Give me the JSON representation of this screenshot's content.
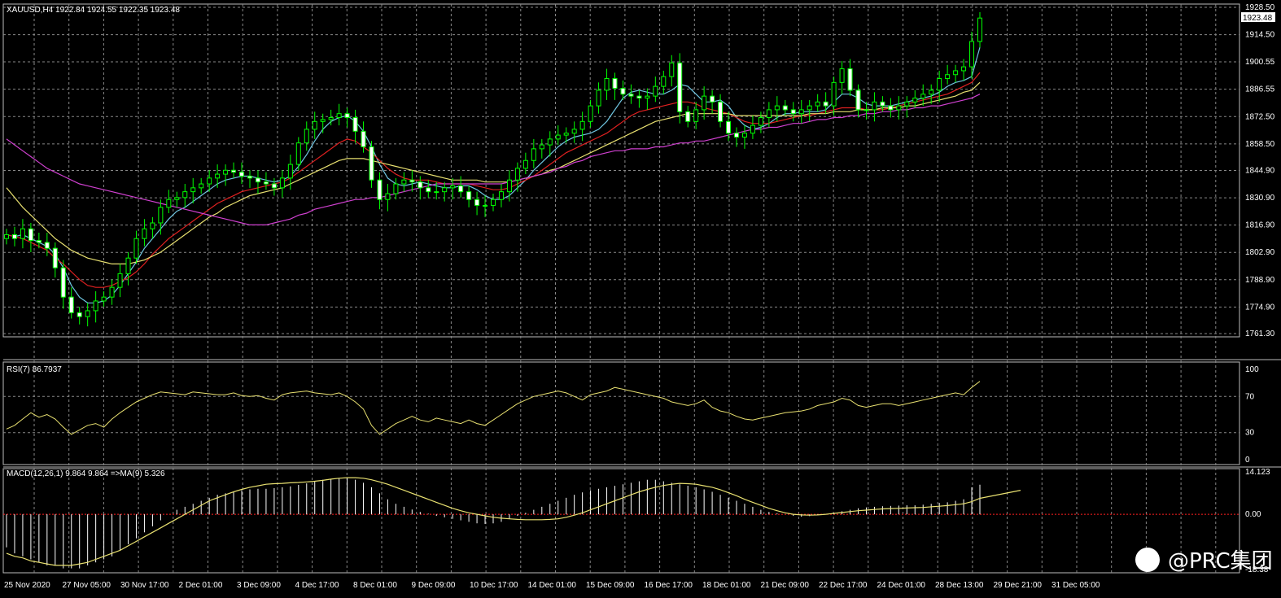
{
  "chart_data": {
    "type": "candlestick",
    "symbol_line": "XAUUSD,H4  1922.84 1924.55 1922.35 1923.48",
    "price_ticks": [
      "1928.50",
      "1914.50",
      "1900.55",
      "1886.55",
      "1872.50",
      "1858.50",
      "1844.90",
      "1830.90",
      "1816.90",
      "1802.90",
      "1788.90",
      "1774.90",
      "1761.30"
    ],
    "current_price": "1923.48",
    "ylim": [
      1761.3,
      1928.5
    ],
    "x_labels": [
      "25 Nov 2020",
      "27 Nov 05:00",
      "30 Nov 17:00",
      "2 Dec 01:00",
      "3 Dec 09:00",
      "4 Dec 17:00",
      "8 Dec 01:00",
      "9 Dec 09:00",
      "10 Dec 17:00",
      "14 Dec 01:00",
      "15 Dec 09:00",
      "16 Dec 17:00",
      "18 Dec 01:00",
      "21 Dec 09:00",
      "22 Dec 17:00",
      "24 Dec 01:00",
      "28 Dec 13:00",
      "29 Dec 21:00",
      "31 Dec 05:00"
    ],
    "price_series": [
      {
        "color": "#6fc5e0",
        "values": [
          1812,
          1811,
          1812,
          1810,
          1808,
          1806,
          1802,
          1795,
          1786,
          1780,
          1777,
          1777,
          1778,
          1781,
          1786,
          1792,
          1798,
          1805,
          1810,
          1815,
          1820,
          1824,
          1826,
          1829,
          1832,
          1835,
          1838,
          1840,
          1841,
          1842,
          1842,
          1841,
          1840,
          1839,
          1840,
          1842,
          1847,
          1853,
          1860,
          1866,
          1870,
          1872,
          1873,
          1870,
          1865,
          1857,
          1848,
          1841,
          1838,
          1837,
          1838,
          1839,
          1838,
          1837,
          1836,
          1836,
          1837,
          1837,
          1835,
          1832,
          1830,
          1830,
          1832,
          1836,
          1840,
          1845,
          1849,
          1853,
          1857,
          1860,
          1862,
          1863,
          1864,
          1866,
          1870,
          1876,
          1882,
          1885,
          1886,
          1885,
          1884,
          1884,
          1886,
          1889,
          1888,
          1884,
          1880,
          1880,
          1881,
          1878,
          1872,
          1868,
          1866,
          1867,
          1869,
          1872,
          1874,
          1874,
          1875,
          1875,
          1875,
          1876,
          1880,
          1884,
          1884,
          1882,
          1879,
          1878,
          1878,
          1878,
          1879,
          1880,
          1881,
          1882,
          1883,
          1885,
          1888,
          1890,
          1891,
          1893,
          1908
        ]
      },
      {
        "color": "#e02020",
        "values": [
          1812,
          1811,
          1810,
          1808,
          1806,
          1804,
          1800,
          1797,
          1793,
          1789,
          1786,
          1785,
          1785,
          1786,
          1788,
          1790,
          1793,
          1797,
          1802,
          1806,
          1810,
          1813,
          1816,
          1819,
          1822,
          1825,
          1828,
          1830,
          1832,
          1834,
          1835,
          1836,
          1837,
          1838,
          1839,
          1841,
          1844,
          1847,
          1850,
          1853,
          1856,
          1859,
          1861,
          1860,
          1857,
          1854,
          1850,
          1846,
          1843,
          1841,
          1840,
          1840,
          1840,
          1839,
          1838,
          1838,
          1838,
          1838,
          1837,
          1836,
          1835,
          1835,
          1836,
          1838,
          1840,
          1842,
          1845,
          1848,
          1851,
          1854,
          1856,
          1858,
          1860,
          1862,
          1864,
          1867,
          1870,
          1873,
          1875,
          1876,
          1877,
          1878,
          1879,
          1880,
          1880,
          1879,
          1877,
          1876,
          1875,
          1874,
          1872,
          1870,
          1869,
          1869,
          1869,
          1870,
          1871,
          1872,
          1873,
          1873,
          1874,
          1875,
          1876,
          1877,
          1877,
          1877,
          1876,
          1876,
          1876,
          1877,
          1878,
          1879,
          1880,
          1881,
          1882,
          1883,
          1884,
          1886,
          1888,
          1890,
          1895
        ]
      },
      {
        "color": "#e8e070",
        "values": [
          1836,
          1831,
          1826,
          1822,
          1818,
          1814,
          1810,
          1807,
          1804,
          1802,
          1800,
          1799,
          1798,
          1797,
          1797,
          1797,
          1798,
          1799,
          1801,
          1803,
          1806,
          1809,
          1812,
          1815,
          1818,
          1821,
          1823,
          1826,
          1828,
          1830,
          1832,
          1833,
          1834,
          1835,
          1836,
          1838,
          1840,
          1842,
          1844,
          1846,
          1848,
          1850,
          1851,
          1851,
          1851,
          1850,
          1849,
          1848,
          1847,
          1846,
          1845,
          1844,
          1843,
          1842,
          1841,
          1840,
          1840,
          1840,
          1840,
          1839,
          1839,
          1839,
          1839,
          1840,
          1841,
          1842,
          1843,
          1845,
          1846,
          1848,
          1850,
          1852,
          1854,
          1856,
          1858,
          1860,
          1862,
          1864,
          1866,
          1868,
          1870,
          1871,
          1872,
          1873,
          1874,
          1874,
          1874,
          1874,
          1874,
          1874,
          1873,
          1873,
          1873,
          1873,
          1873,
          1873,
          1873,
          1873,
          1873,
          1874,
          1874,
          1874,
          1875,
          1875,
          1875,
          1876,
          1876,
          1876,
          1877,
          1877,
          1877,
          1878,
          1878,
          1879,
          1880,
          1881,
          1882,
          1883,
          1885,
          1886,
          1890
        ]
      },
      {
        "color": "#d040d0",
        "values": [
          1861,
          1858,
          1855,
          1852,
          1849,
          1846,
          1844,
          1842,
          1840,
          1838,
          1837,
          1836,
          1835,
          1834,
          1833,
          1832,
          1831,
          1830,
          1829,
          1828,
          1827,
          1826,
          1825,
          1824,
          1823,
          1822,
          1821,
          1820,
          1819,
          1818,
          1817,
          1817,
          1817,
          1818,
          1819,
          1820,
          1822,
          1823,
          1825,
          1826,
          1827,
          1828,
          1829,
          1830,
          1830,
          1831,
          1831,
          1832,
          1833,
          1834,
          1835,
          1836,
          1837,
          1838,
          1838,
          1838,
          1838,
          1838,
          1838,
          1838,
          1838,
          1838,
          1839,
          1840,
          1841,
          1842,
          1843,
          1844,
          1846,
          1847,
          1849,
          1850,
          1852,
          1853,
          1854,
          1855,
          1855,
          1856,
          1856,
          1856,
          1857,
          1857,
          1858,
          1859,
          1859,
          1860,
          1860,
          1861,
          1862,
          1863,
          1864,
          1865,
          1866,
          1866,
          1867,
          1867,
          1868,
          1869,
          1869,
          1870,
          1871,
          1871,
          1872,
          1872,
          1873,
          1873,
          1874,
          1874,
          1875,
          1875,
          1876,
          1876,
          1877,
          1877,
          1878,
          1878,
          1879,
          1880,
          1881,
          1882,
          1884
        ]
      }
    ],
    "candle_closes": [
      1812,
      1810,
      1815,
      1809,
      1808,
      1805,
      1795,
      1780,
      1772,
      1770,
      1773,
      1778,
      1780,
      1785,
      1792,
      1800,
      1810,
      1815,
      1818,
      1826,
      1830,
      1831,
      1834,
      1836,
      1838,
      1841,
      1843,
      1845,
      1844,
      1842,
      1841,
      1839,
      1838,
      1836,
      1841,
      1848,
      1859,
      1866,
      1870,
      1871,
      1872,
      1874,
      1872,
      1865,
      1857,
      1840,
      1830,
      1833,
      1838,
      1840,
      1839,
      1836,
      1834,
      1834,
      1836,
      1837,
      1834,
      1830,
      1827,
      1827,
      1830,
      1834,
      1840,
      1846,
      1850,
      1856,
      1858,
      1861,
      1863,
      1864,
      1866,
      1870,
      1878,
      1886,
      1892,
      1887,
      1884,
      1883,
      1882,
      1883,
      1888,
      1893,
      1900,
      1875,
      1870,
      1876,
      1883,
      1880,
      1870,
      1864,
      1862,
      1864,
      1868,
      1872,
      1876,
      1878,
      1876,
      1874,
      1876,
      1878,
      1880,
      1878,
      1890,
      1897,
      1886,
      1876,
      1876,
      1880,
      1878,
      1876,
      1878,
      1880,
      1882,
      1884,
      1886,
      1892,
      1894,
      1896,
      1898,
      1911,
      1923
    ],
    "rsi": {
      "label": "RSI(7) 86.7937",
      "levels": [
        "100",
        "70",
        "30",
        "0"
      ],
      "ylim": [
        0,
        100
      ],
      "values": [
        34,
        38,
        45,
        52,
        47,
        50,
        45,
        36,
        28,
        33,
        38,
        40,
        36,
        45,
        52,
        58,
        64,
        68,
        72,
        75,
        74,
        73,
        72,
        75,
        74,
        73,
        72,
        72,
        74,
        71,
        70,
        71,
        68,
        66,
        72,
        74,
        75,
        76,
        74,
        73,
        72,
        74,
        70,
        64,
        56,
        38,
        28,
        34,
        40,
        44,
        48,
        44,
        42,
        46,
        44,
        42,
        40,
        44,
        40,
        38,
        44,
        50,
        56,
        62,
        66,
        70,
        72,
        74,
        76,
        74,
        70,
        66,
        72,
        74,
        76,
        80,
        78,
        76,
        74,
        72,
        70,
        68,
        64,
        62,
        60,
        62,
        66,
        58,
        54,
        52,
        48,
        45,
        44,
        46,
        48,
        50,
        52,
        53,
        54,
        56,
        60,
        62,
        64,
        68,
        66,
        60,
        58,
        60,
        62,
        62,
        60,
        62,
        64,
        66,
        68,
        70,
        72,
        74,
        72,
        80,
        86.8
      ]
    },
    "macd": {
      "label": "MACD(12,26,1) 9.864 9.864 =>MA(9) 5.326",
      "levels": [
        "14.123",
        "0.00",
        "-18.38"
      ],
      "ylim": [
        -18.38,
        14.123
      ],
      "hist": [
        -11,
        -13,
        -14,
        -15,
        -16,
        -17,
        -17,
        -18,
        -18,
        -18,
        -17,
        -16,
        -15,
        -14,
        -12,
        -10,
        -8,
        -6,
        -4,
        -2,
        0,
        1.5,
        2.5,
        3.5,
        4.5,
        5.5,
        6.5,
        7,
        7.5,
        8,
        8.3,
        8.5,
        8.5,
        8.7,
        9,
        9.3,
        9.8,
        10.3,
        11,
        11.5,
        11.8,
        12,
        12,
        11.5,
        10.5,
        9,
        7,
        5,
        3.5,
        2.5,
        1.6,
        0.8,
        0.2,
        -0.5,
        -1,
        -1.5,
        -2,
        -2.5,
        -3,
        -3.2,
        -3,
        -2.5,
        -1.5,
        -0.5,
        0.5,
        1.5,
        2.5,
        3.5,
        4.5,
        5.5,
        6.5,
        7.3,
        8,
        8.5,
        9,
        9.5,
        10,
        10.5,
        11,
        11.5,
        11.5,
        11,
        10.5,
        10,
        9.5,
        9,
        8.3,
        7.5,
        6.5,
        5.5,
        4.5,
        3.5,
        2.5,
        1.5,
        0.8,
        0.3,
        0,
        -0.5,
        -0.8,
        -0.6,
        -0.3,
        0,
        0.5,
        1,
        1.5,
        2,
        2.3,
        2.5,
        2.7,
        2.8,
        2.9,
        3,
        3,
        3.2,
        3.5,
        3.8,
        4,
        4.5,
        5,
        9,
        9.864
      ],
      "signal": [
        -13,
        -14,
        -14.5,
        -15.5,
        -16,
        -16.5,
        -17,
        -17,
        -17,
        -16.5,
        -16,
        -15,
        -14,
        -13,
        -12,
        -10.5,
        -9,
        -7.5,
        -6,
        -4.5,
        -3,
        -1.5,
        0,
        1.5,
        3,
        4.5,
        5.5,
        6.5,
        7.5,
        8.3,
        9,
        9.5,
        10,
        10.2,
        10.3,
        10.5,
        10.6,
        10.8,
        11,
        11.3,
        11.7,
        12,
        12.2,
        12.2,
        12,
        11.5,
        10.8,
        10,
        9,
        8,
        7,
        6,
        5,
        4,
        3,
        2,
        1.2,
        0.5,
        0,
        -0.5,
        -1,
        -1.3,
        -1.5,
        -1.7,
        -1.8,
        -1.8,
        -1.8,
        -1.7,
        -1.5,
        -1,
        -0.3,
        0.5,
        1.5,
        2.5,
        3.5,
        4.5,
        5.5,
        6.5,
        7.5,
        8.3,
        9,
        9.6,
        10,
        10.3,
        10.2,
        10,
        9.5,
        9,
        8.2,
        7.2,
        6.2,
        5,
        4,
        3,
        2,
        1.2,
        0.5,
        0,
        -0.2,
        -0.3,
        -0.2,
        0,
        0.3,
        0.6,
        0.9,
        1.2,
        1.4,
        1.6,
        1.8,
        1.9,
        2,
        2.1,
        2.2,
        2.3,
        2.5,
        2.7,
        2.9,
        3.2,
        3.5,
        4.2,
        5.326
      ]
    }
  },
  "watermark": "@PRC集团",
  "colors": {
    "background": "#000000",
    "grid": "#aaaaaa",
    "bull": "#00ff00",
    "bear": "#00ff00",
    "rsi": "#e8e070",
    "macd_hist": "#ffffff",
    "macd_signal": "#e8e070",
    "zero_line": "#ff2020"
  }
}
